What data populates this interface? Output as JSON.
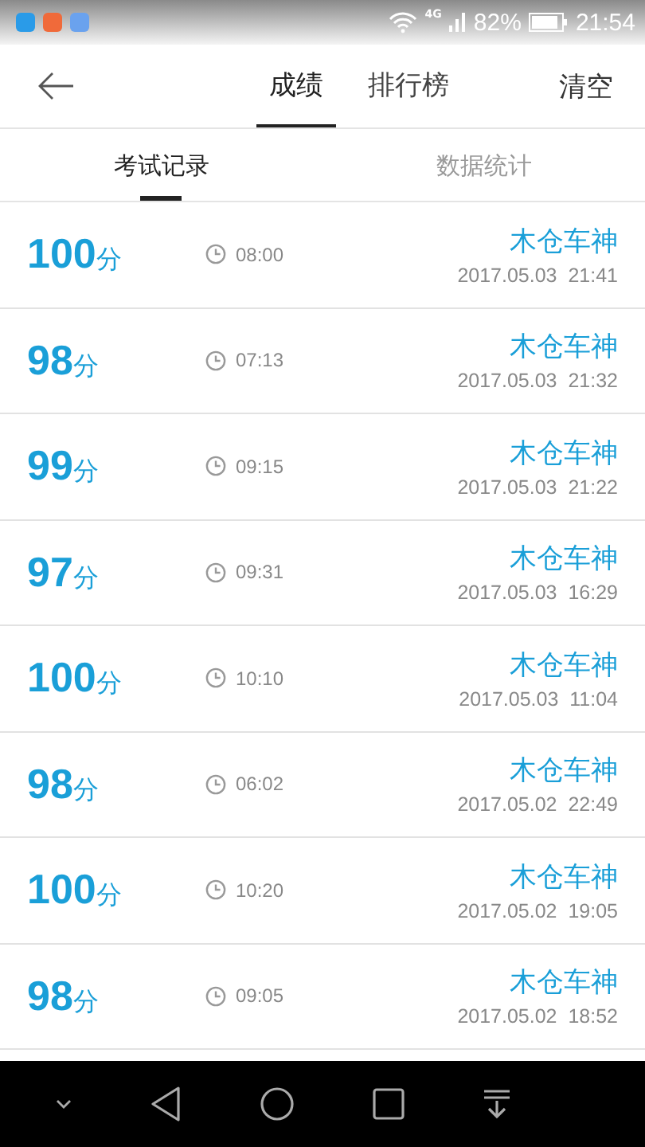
{
  "status_bar": {
    "network": "4G",
    "battery": "82%",
    "time": "21:54",
    "notifications": [
      {
        "color": "#2a9be8"
      },
      {
        "color": "#f06a3a"
      },
      {
        "color": "#6aa2ee"
      }
    ]
  },
  "header": {
    "tabs": [
      {
        "label": "成绩",
        "selected": true
      },
      {
        "label": "排行榜",
        "selected": false
      }
    ],
    "action": "清空"
  },
  "sub_tabs": [
    {
      "label": "考试记录",
      "selected": true
    },
    {
      "label": "数据统计",
      "selected": false
    }
  ],
  "records": [
    {
      "score": "100",
      "unit": "分",
      "duration": "08:00",
      "name": "木仓车神",
      "date": "2017.05.03  21:41"
    },
    {
      "score": "98",
      "unit": "分",
      "duration": "07:13",
      "name": "木仓车神",
      "date": "2017.05.03  21:32"
    },
    {
      "score": "99",
      "unit": "分",
      "duration": "09:15",
      "name": "木仓车神",
      "date": "2017.05.03  21:22"
    },
    {
      "score": "97",
      "unit": "分",
      "duration": "09:31",
      "name": "木仓车神",
      "date": "2017.05.03  16:29"
    },
    {
      "score": "100",
      "unit": "分",
      "duration": "10:10",
      "name": "木仓车神",
      "date": "2017.05.03  11:04"
    },
    {
      "score": "98",
      "unit": "分",
      "duration": "06:02",
      "name": "木仓车神",
      "date": "2017.05.02  22:49"
    },
    {
      "score": "100",
      "unit": "分",
      "duration": "10:20",
      "name": "木仓车神",
      "date": "2017.05.02  19:05"
    },
    {
      "score": "98",
      "unit": "分",
      "duration": "09:05",
      "name": "木仓车神",
      "date": "2017.05.02  18:52"
    }
  ]
}
